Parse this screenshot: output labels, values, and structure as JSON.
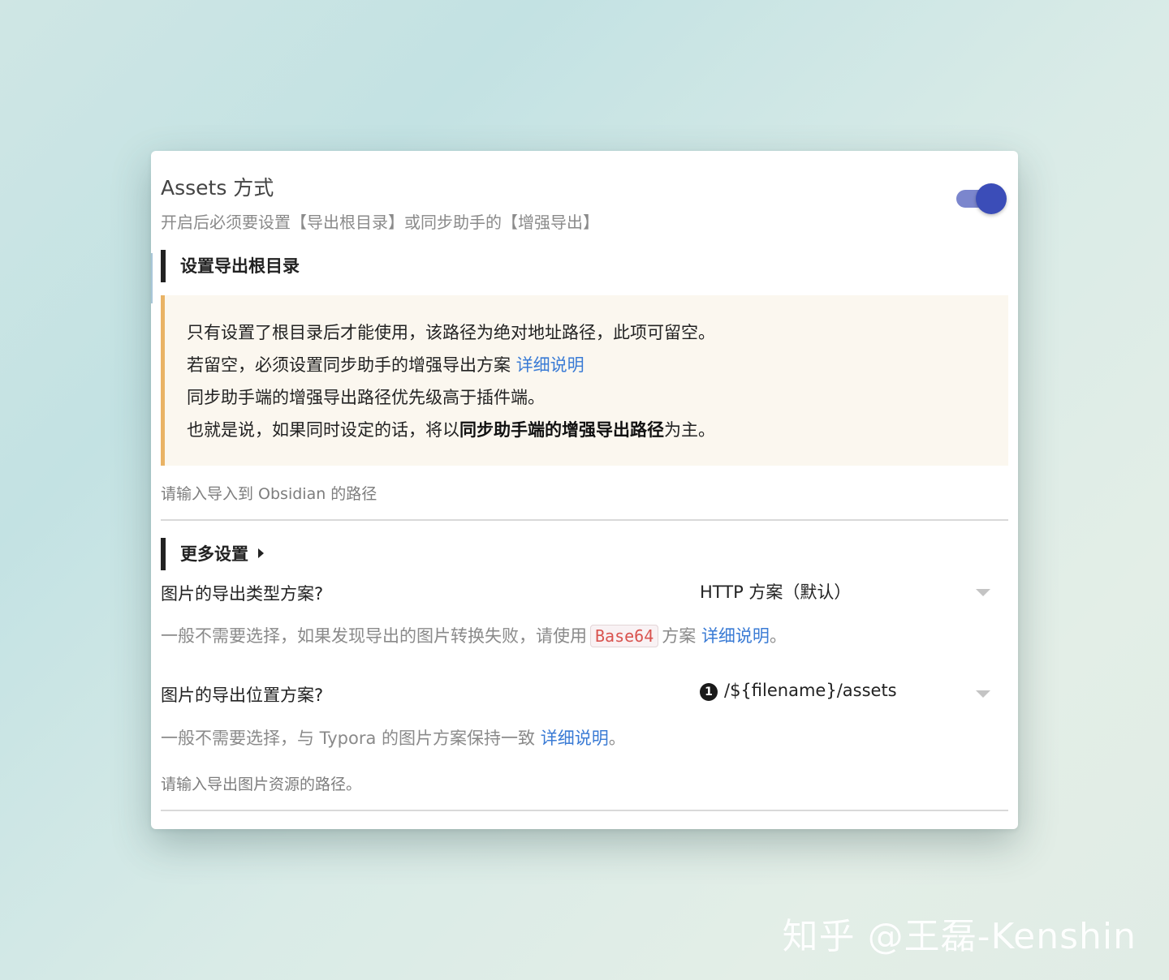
{
  "card": {
    "title": "Assets 方式",
    "subtitle": "开启后必须要设置【导出根目录】或同步助手的【增强导出】",
    "toggle_on": true
  },
  "section1": {
    "heading": "设置导出根目录"
  },
  "callout": {
    "line1": "只有设置了根目录后才能使用，该路径为绝对地址路径，此项可留空。",
    "line2_text": "若留空，必须设置同步助手的增强导出方案 ",
    "line2_link": "详细说明",
    "line3": "同步助手端的增强导出路径优先级高于插件端。",
    "line4_pre": "也就是说，如果同时设定的话，将以",
    "line4_bold": "同步助手端的增强导出路径",
    "line4_post": "为主。"
  },
  "root_input": {
    "placeholder": "请输入导入到 Obsidian 的路径"
  },
  "section2": {
    "heading": "更多设置"
  },
  "image_type": {
    "label": "图片的导出类型方案?",
    "selected": "HTTP 方案（默认）",
    "hint_pre": "一般不需要选择，如果发现导出的图片转换失败，请使用",
    "hint_code": "Base64",
    "hint_mid": "方案 ",
    "hint_link": "详细说明",
    "hint_post": "。"
  },
  "image_location": {
    "label": "图片的导出位置方案?",
    "badge": "1",
    "selected": "/${filename}/assets",
    "hint_pre": "一般不需要选择，与 Typora 的图片方案保持一致 ",
    "hint_link": "详细说明",
    "hint_post": "。"
  },
  "asset_input": {
    "placeholder": "请输入导出图片资源的路径。"
  },
  "watermark": "知乎 @王磊-Kenshin",
  "colors": {
    "accent": "#3b4db8",
    "link": "#3a7bd5",
    "callout_border": "#e9b365",
    "code": "#d9534f"
  }
}
